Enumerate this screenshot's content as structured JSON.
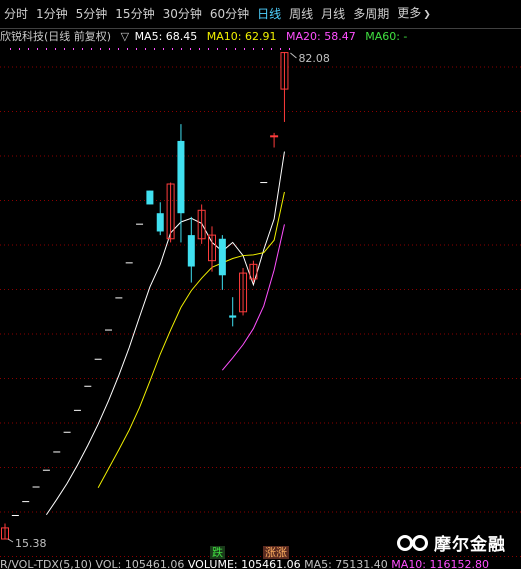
{
  "tabs": [
    {
      "label": "分时",
      "active": false
    },
    {
      "label": "1分钟",
      "active": false
    },
    {
      "label": "5分钟",
      "active": false
    },
    {
      "label": "15分钟",
      "active": false
    },
    {
      "label": "30分钟",
      "active": false
    },
    {
      "label": "60分钟",
      "active": false
    },
    {
      "label": "日线",
      "active": true
    },
    {
      "label": "周线",
      "active": false
    },
    {
      "label": "月线",
      "active": false
    },
    {
      "label": "多周期",
      "active": false
    },
    {
      "label": "更多",
      "active": false
    }
  ],
  "info": {
    "title": "欣锐科技(日线 前复权)",
    "marker": "▽",
    "ma5": "MA5: 68.45",
    "ma10": "MA10: 62.91",
    "ma20": "MA20: 58.47",
    "ma60": "MA60: -"
  },
  "price_labels": {
    "high": "82.08",
    "low": "15.38"
  },
  "tags": {
    "fall": "跌",
    "rise": "涨涨"
  },
  "logo": {
    "text": "摩尔金融"
  },
  "bottom": {
    "left": "R/VOL-TDX(5,10)  VOL: 105461.06",
    "volume": "VOLUME: 105461.06",
    "ma5": "MA5: 75131.40",
    "ma10": "MA10: 116152.80"
  },
  "colors": {
    "up": "#ff3c3c",
    "down": "#40e0f0",
    "ma5": "#ffffff",
    "ma10": "#f0f000",
    "ma20": "#ff50ff",
    "grid": "#8b0000"
  },
  "chart_data": {
    "type": "candlestick",
    "price_range": [
      15.38,
      82.08
    ],
    "candles": [
      {
        "o": 15.38,
        "h": 17.5,
        "l": 15.38,
        "c": 16.9
      },
      {
        "o": 18.6,
        "h": 18.6,
        "l": 18.6,
        "c": 18.6
      },
      {
        "o": 20.5,
        "h": 20.5,
        "l": 20.5,
        "c": 20.5
      },
      {
        "o": 22.5,
        "h": 22.5,
        "l": 22.5,
        "c": 22.5
      },
      {
        "o": 24.8,
        "h": 24.8,
        "l": 24.8,
        "c": 24.8
      },
      {
        "o": 27.3,
        "h": 27.3,
        "l": 27.3,
        "c": 27.3
      },
      {
        "o": 30.0,
        "h": 30.0,
        "l": 30.0,
        "c": 30.0
      },
      {
        "o": 33.0,
        "h": 33.0,
        "l": 33.0,
        "c": 33.0
      },
      {
        "o": 36.3,
        "h": 36.3,
        "l": 36.3,
        "c": 36.3
      },
      {
        "o": 40.0,
        "h": 40.0,
        "l": 40.0,
        "c": 40.0
      },
      {
        "o": 44.0,
        "h": 44.0,
        "l": 44.0,
        "c": 44.0
      },
      {
        "o": 48.4,
        "h": 48.4,
        "l": 48.4,
        "c": 48.4
      },
      {
        "o": 53.2,
        "h": 53.2,
        "l": 53.2,
        "c": 53.2
      },
      {
        "o": 58.5,
        "h": 58.5,
        "l": 58.5,
        "c": 58.5
      },
      {
        "o": 63.1,
        "h": 63.1,
        "l": 61.2,
        "c": 61.2
      },
      {
        "o": 60.0,
        "h": 61.5,
        "l": 57.0,
        "c": 57.5
      },
      {
        "o": 56.5,
        "h": 64.2,
        "l": 56.0,
        "c": 64.0
      },
      {
        "o": 69.9,
        "h": 72.2,
        "l": 56.0,
        "c": 60.0
      },
      {
        "o": 57.0,
        "h": 59.5,
        "l": 50.5,
        "c": 52.7
      },
      {
        "o": 56.5,
        "h": 61.2,
        "l": 55.8,
        "c": 60.4
      },
      {
        "o": 53.5,
        "h": 58.2,
        "l": 52.0,
        "c": 57.0
      },
      {
        "o": 56.5,
        "h": 57.0,
        "l": 49.5,
        "c": 51.5
      },
      {
        "o": 46.0,
        "h": 48.5,
        "l": 44.5,
        "c": 45.7
      },
      {
        "o": 46.5,
        "h": 52.5,
        "l": 46.0,
        "c": 51.8
      },
      {
        "o": 51.0,
        "h": 53.5,
        "l": 50.5,
        "c": 53.0
      },
      {
        "o": 64.2,
        "h": 64.2,
        "l": 64.2,
        "c": 64.2
      },
      {
        "o": 70.5,
        "h": 71.0,
        "l": 69.0,
        "c": 70.6
      },
      {
        "o": 77.0,
        "h": 82.08,
        "l": 72.5,
        "c": 82.0
      }
    ],
    "ma5": [
      null,
      null,
      null,
      null,
      18.7,
      20.8,
      23.0,
      25.5,
      28.2,
      31.1,
      34.3,
      37.8,
      41.6,
      45.8,
      49.9,
      53.0,
      57.3,
      58.8,
      59.3,
      58.6,
      56.0,
      54.8,
      56.0,
      54.2,
      50.2,
      55.0,
      59.2,
      68.45
    ],
    "ma10": [
      null,
      null,
      null,
      null,
      null,
      null,
      null,
      null,
      null,
      22.4,
      25.0,
      27.6,
      30.3,
      33.4,
      37.0,
      40.7,
      44.0,
      47.1,
      49.4,
      51.1,
      52.6,
      53.2,
      53.8,
      54.2,
      54.3,
      54.6,
      56.3,
      62.91
    ],
    "ma20": [
      null,
      null,
      null,
      null,
      null,
      null,
      null,
      null,
      null,
      null,
      null,
      null,
      null,
      null,
      null,
      null,
      null,
      null,
      null,
      null,
      null,
      38.5,
      40.2,
      42.0,
      44.2,
      47.3,
      52.2,
      58.47
    ]
  }
}
